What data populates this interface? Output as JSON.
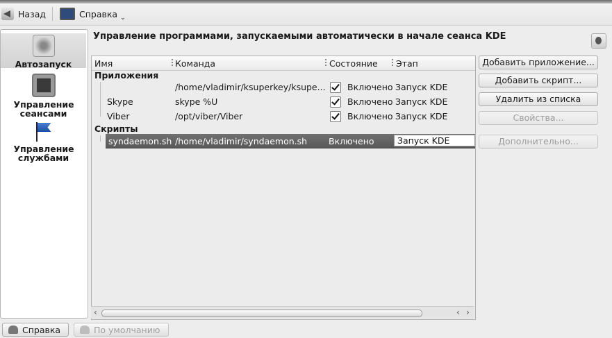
{
  "toolbar": {
    "back_label": "Назад",
    "help_label": "Справка"
  },
  "sidebar": {
    "items": [
      {
        "label": "Автозапуск",
        "icon": "autostart-icon",
        "selected": true
      },
      {
        "label": "Управление сеансами",
        "icon": "session-manager-icon",
        "selected": false
      },
      {
        "label": "Управление службами",
        "icon": "flag-icon",
        "selected": false
      }
    ]
  },
  "main": {
    "title": "Управление программами, запускаемыми автоматически в начале сеанса KDE",
    "columns": [
      "Имя",
      "Команда",
      "Состояние",
      "Этап"
    ],
    "groups": [
      {
        "label": "Приложения",
        "rows": [
          {
            "name": "",
            "command": "/home/vladimir/ksuperkey/ksupe...",
            "state": "Включено",
            "stage": "Запуск KDE",
            "checked": true
          },
          {
            "name": "Skype",
            "command": "skype %U",
            "state": "Включено",
            "stage": "Запуск KDE",
            "checked": true
          },
          {
            "name": "Viber",
            "command": "/opt/viber/Viber",
            "state": "Включено",
            "stage": "Запуск KDE",
            "checked": true
          }
        ]
      },
      {
        "label": "Скрипты",
        "rows": [
          {
            "name": "syndaemon.sh",
            "command": "/home/vladimir/syndaemon.sh",
            "state": "Включено",
            "stage": "Запуск KDE",
            "selected": true
          }
        ]
      }
    ]
  },
  "buttons": {
    "add_app": "Добавить приложение...",
    "add_script": "Добавить скрипт...",
    "remove": "Удалить из списка",
    "properties": "Свойства...",
    "advanced": "Дополнительно..."
  },
  "bottom": {
    "help": "Справка",
    "defaults": "По умолчанию"
  }
}
